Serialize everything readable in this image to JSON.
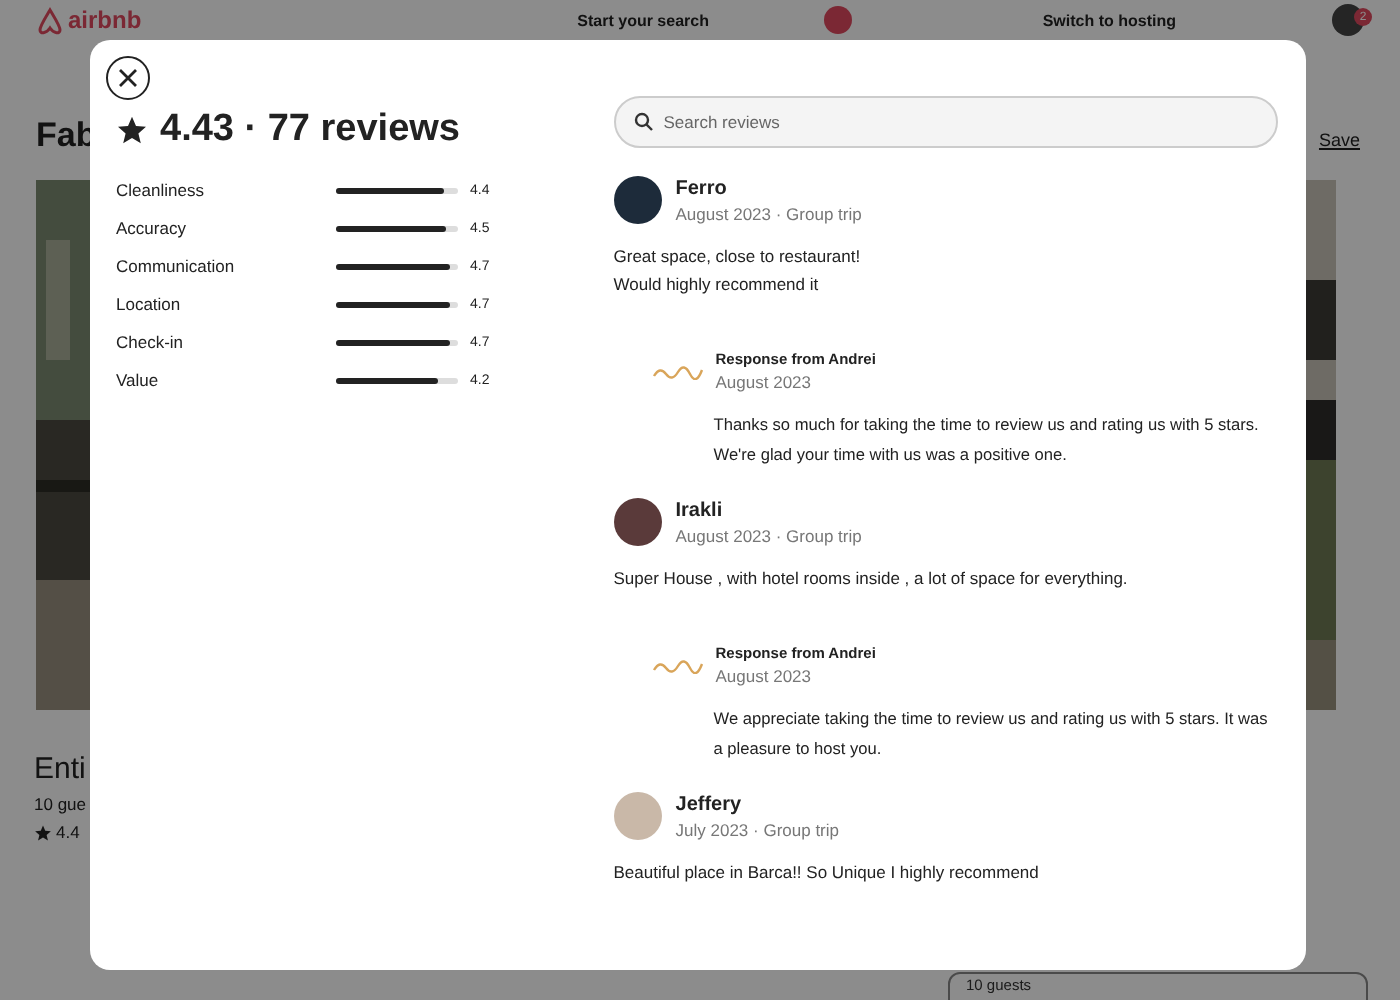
{
  "background": {
    "logo": "airbnb",
    "search": "Start your search",
    "host_link": "Switch to hosting",
    "notification_count": "2",
    "title": "Fab",
    "save": "Save",
    "listing_title": "Enti",
    "guests": "10 gue",
    "rating": "4.4",
    "guests_field": "10 guests"
  },
  "modal": {
    "summary": "4.43 · 77 reviews",
    "categories": [
      {
        "label": "Cleanliness",
        "level": 0.88,
        "score": "4.4"
      },
      {
        "label": "Accuracy",
        "level": 0.9,
        "score": "4.5"
      },
      {
        "label": "Communication",
        "level": 0.94,
        "score": "4.7"
      },
      {
        "label": "Location",
        "level": 0.94,
        "score": "4.7"
      },
      {
        "label": "Check-in",
        "level": 0.94,
        "score": "4.7"
      },
      {
        "label": "Value",
        "level": 0.84,
        "score": "4.2"
      }
    ],
    "search": {
      "placeholder": "Search reviews"
    },
    "reviews": [
      {
        "name": "Ferro",
        "date": "August 2023 · Group trip",
        "lines": [
          "Great space, close to restaurant!",
          "Would highly recommend it"
        ],
        "response": {
          "title": "Response from Andrei",
          "date": "August 2023",
          "lines": [
            "Thanks so much for taking the time to review us and rating us with 5 stars.",
            "We're glad your time with us was a positive one."
          ]
        }
      },
      {
        "name": "Irakli",
        "date": "August 2023 · Group trip",
        "lines": [
          "Super House , with hotel rooms inside , a lot of space for everything."
        ],
        "response": {
          "title": "Response from Andrei",
          "date": "August 2023",
          "lines": [
            "We appreciate taking the time to review us and rating us with 5 stars. It was",
            "a pleasure to host you."
          ]
        }
      },
      {
        "name": "Jeffery",
        "date": "July 2023 · Group trip",
        "lines": [
          "Beautiful place in Barca!! So Unique I highly recommend"
        ]
      }
    ]
  }
}
